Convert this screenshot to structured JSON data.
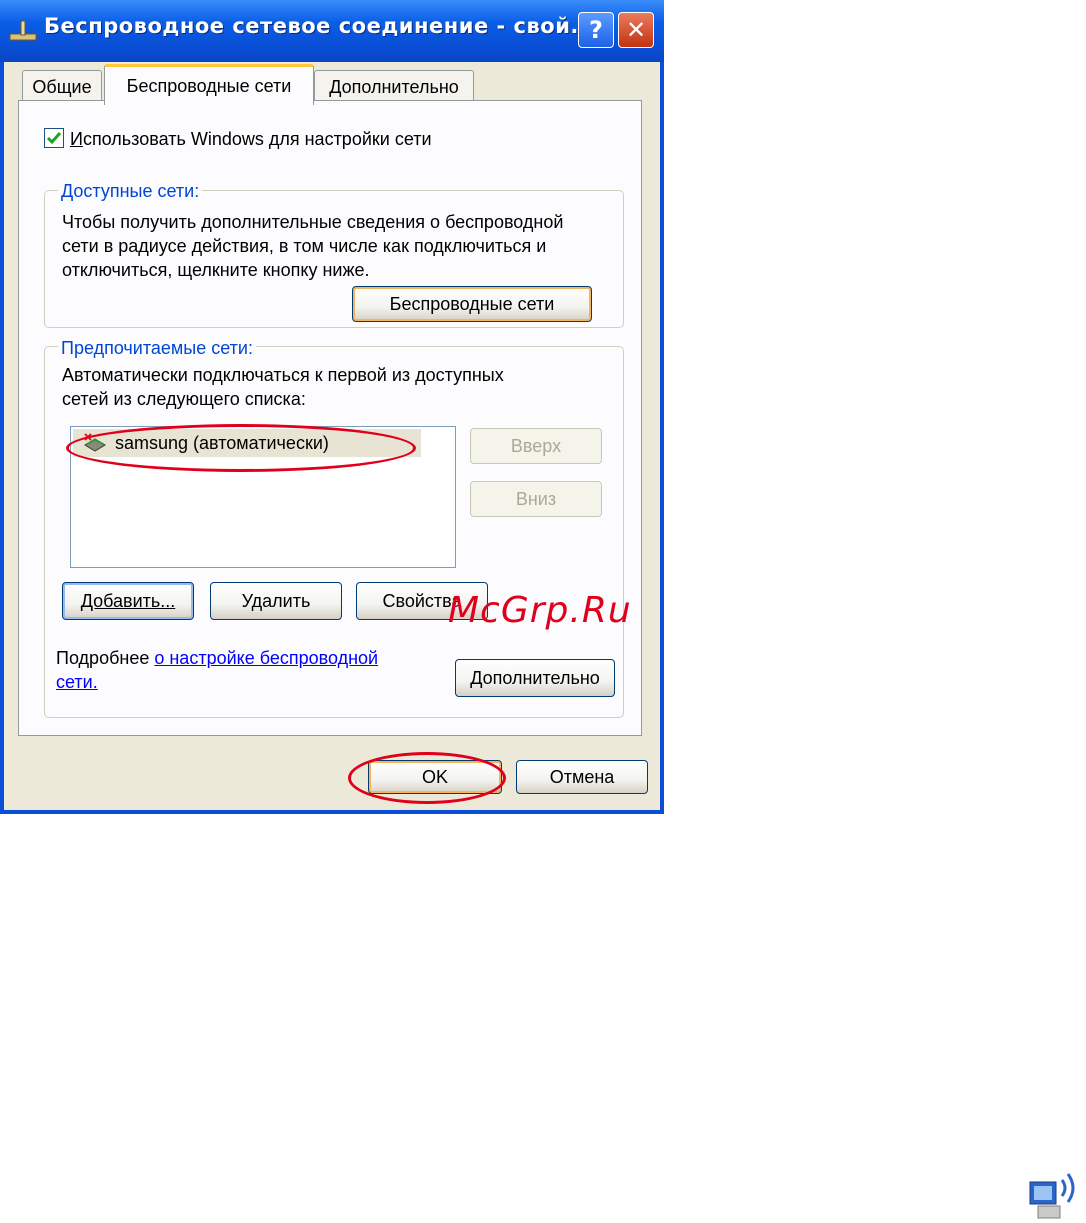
{
  "window": {
    "title": "Беспроводное сетевое соединение - свой...",
    "help_label": "?",
    "close_label": "✕"
  },
  "tabs": [
    {
      "label": "Общие"
    },
    {
      "label": "Беспроводные сети",
      "active": true
    },
    {
      "label": "Дополнительно"
    }
  ],
  "checkbox": {
    "label_first": "И",
    "label_rest": "спользовать Windows для настройки сети",
    "checked": true
  },
  "available": {
    "legend": "Доступные сети:",
    "description": [
      "Чтобы получить дополнительные сведения о беспроводной",
      "сети в радиусе действия, в том числе как подключиться и",
      "отключиться, щелкните кнопку ниже."
    ],
    "button_label": "Беспроводные сети"
  },
  "preferred": {
    "legend": "Предпочитаемые сети:",
    "description": [
      "Автоматически подключаться к первой из доступных",
      "сетей из следующего списка:"
    ],
    "networks": [
      {
        "label": "samsung (автоматически)",
        "icon": "wireless-network-icon"
      }
    ],
    "up_label": "Вверх",
    "down_label": "Вниз",
    "add_label": "Добавить...",
    "remove_label": "Удалить",
    "properties_label": "Свойства"
  },
  "info": {
    "prefix": "Подробнее ",
    "link_line1": "о настройке  беспроводной",
    "link_line2": "сети.",
    "advanced_label": "Дополнительно"
  },
  "footer": {
    "ok_label": "OK",
    "cancel_label": "Отмена"
  },
  "watermark": "McGrp.Ru",
  "colors": {
    "title_bar": "#0a50d8",
    "highlight": "#e0001b",
    "link": "#0000ff",
    "group_legend": "#0046d5"
  }
}
